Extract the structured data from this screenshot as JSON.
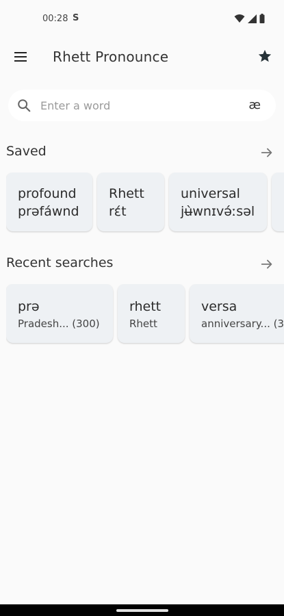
{
  "status_bar": {
    "time": "00:28",
    "app_indicator": "S",
    "icons": [
      "wifi-icon",
      "signal-icon",
      "battery-icon"
    ]
  },
  "app_bar": {
    "title": "Rhett Pronounce",
    "menu_icon": "menu-icon",
    "star_icon": "star-icon"
  },
  "search": {
    "placeholder": "Enter a word",
    "value": "",
    "ipa_key_label": "æ",
    "icon": "search-icon"
  },
  "saved": {
    "title": "Saved",
    "items": [
      {
        "word": "profound",
        "ipa": "prəfáwnd"
      },
      {
        "word": "Rhett",
        "ipa": "rέt"
      },
      {
        "word": "universal",
        "ipa": "jʉ̀wnɪvə́ːsəl"
      },
      {
        "word": "",
        "ipa": ""
      }
    ]
  },
  "recent": {
    "title": "Recent searches",
    "items": [
      {
        "word": "prə",
        "sub": "Pradesh... (300)"
      },
      {
        "word": "rhett",
        "sub": "Rhett"
      },
      {
        "word": "versa",
        "sub": "anniversary... (3"
      }
    ]
  },
  "colors": {
    "background": "#fafafa",
    "card": "#eef1f4",
    "text": "#2b2b2b"
  }
}
